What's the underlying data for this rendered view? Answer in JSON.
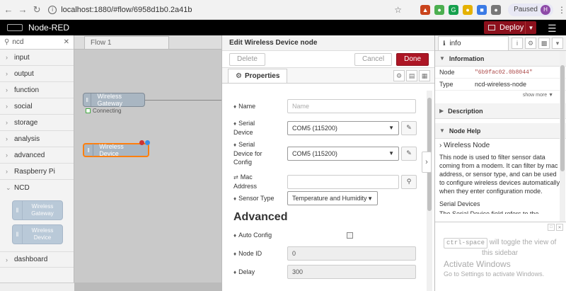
{
  "browser": {
    "url": "localhost:1880/#flow/6958d1b0.2a41b",
    "paused_label": "Paused",
    "avatar_initial": "H"
  },
  "app": {
    "title": "Node-RED",
    "deploy_label": "Deploy"
  },
  "palette": {
    "search_value": "ncd",
    "categories": [
      "input",
      "output",
      "function",
      "social",
      "storage",
      "analysis",
      "advanced",
      "Raspberry Pi",
      "NCD"
    ],
    "ncd_nodes": [
      "Wireless Gateway",
      "Wireless Device"
    ],
    "last_category": "dashboard"
  },
  "workspace": {
    "tab_label": "Flow 1",
    "gateway_node": "Wireless Gateway",
    "gateway_status": "Connecting",
    "device_node": "Wireless Device"
  },
  "dialog": {
    "title": "Edit Wireless Device node",
    "delete_label": "Delete",
    "cancel_label": "Cancel",
    "done_label": "Done",
    "tab_properties": "Properties",
    "name_label": "Name",
    "name_placeholder": "Name",
    "serial_device_label": "Serial Device",
    "serial_device_value": "COM5 (115200)",
    "serial_config_label": "Serial Device for Config",
    "serial_config_value": "COM5 (115200)",
    "mac_label": "Mac Address",
    "sensor_type_label": "Sensor Type",
    "sensor_type_value": "Temperature and Humidity",
    "advanced_title": "Advanced",
    "auto_config_label": "Auto Config",
    "node_id_label": "Node ID",
    "node_id_value": "0",
    "delay_label": "Delay",
    "delay_value": "300"
  },
  "sidebar": {
    "tab_label": "info",
    "information_header": "Information",
    "node_key": "Node",
    "node_value": "\"6b9fac02.0b8044\"",
    "type_key": "Type",
    "type_value": "ncd-wireless-node",
    "show_more": "show more",
    "description_header": "Description",
    "help_header": "Node Help",
    "help_title": "Wireless Node",
    "help_text": "This node is used to filter sensor data coming from a modem. It can filter by mac address, or sensor type, and can be used to configure wireless devices automatically when they enter configuration mode.",
    "help_subtitle": "Serial Devices",
    "help_partial": "The Serial Device field refers to the modem",
    "tip_key": "ctrl-space",
    "tip_text_1": "will toggle the view of",
    "tip_text_2": "this sidebar",
    "activate_title": "Activate Windows",
    "activate_sub": "Go to Settings to activate Windows."
  }
}
